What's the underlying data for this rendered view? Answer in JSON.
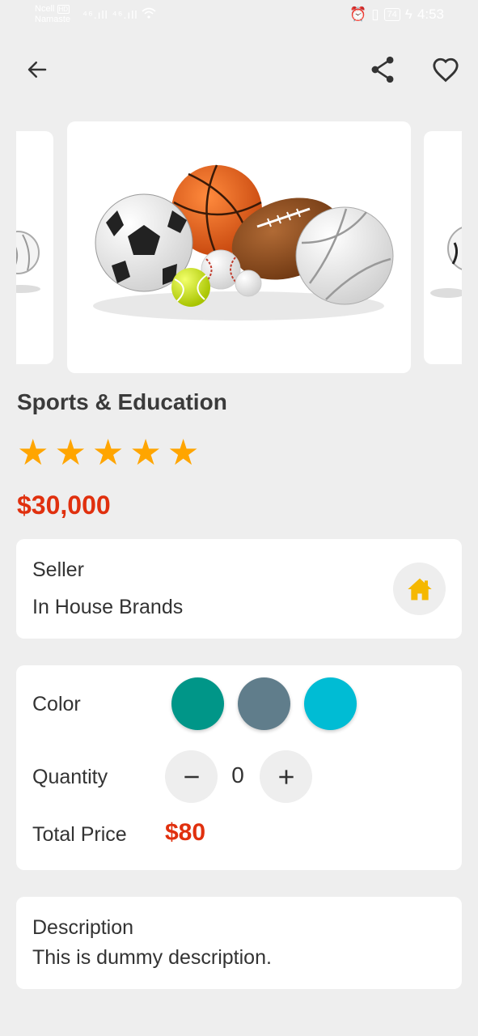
{
  "status_bar": {
    "carrier": "Ncell",
    "carrier_badge": "HD",
    "network_name": "Namaste",
    "battery": "74",
    "time": "4:53"
  },
  "appbar": {
    "back_icon": "arrow-left-icon",
    "share_icon": "share-icon",
    "favorite_icon": "heart-outline-icon"
  },
  "product": {
    "title": "Sports & Education",
    "rating": 5,
    "rating_max": 5,
    "price": "$30,000",
    "image_subject": "sports balls"
  },
  "seller": {
    "label": "Seller",
    "name": "In House Brands",
    "icon": "home-icon"
  },
  "options": {
    "color_label": "Color",
    "colors": [
      "#009688",
      "#607d8b",
      "#00bcd4"
    ],
    "quantity_label": "Quantity",
    "quantity": "0",
    "decrement_icon": "minus-icon",
    "increment_icon": "plus-icon",
    "total_label": "Total Price",
    "total_value": "$80"
  },
  "description": {
    "label": "Description",
    "text": "This is dummy description."
  },
  "colors": {
    "accent": "#e0300e",
    "star": "#ffa500",
    "home_icon": "#f5b800",
    "background": "#eeeeee"
  }
}
